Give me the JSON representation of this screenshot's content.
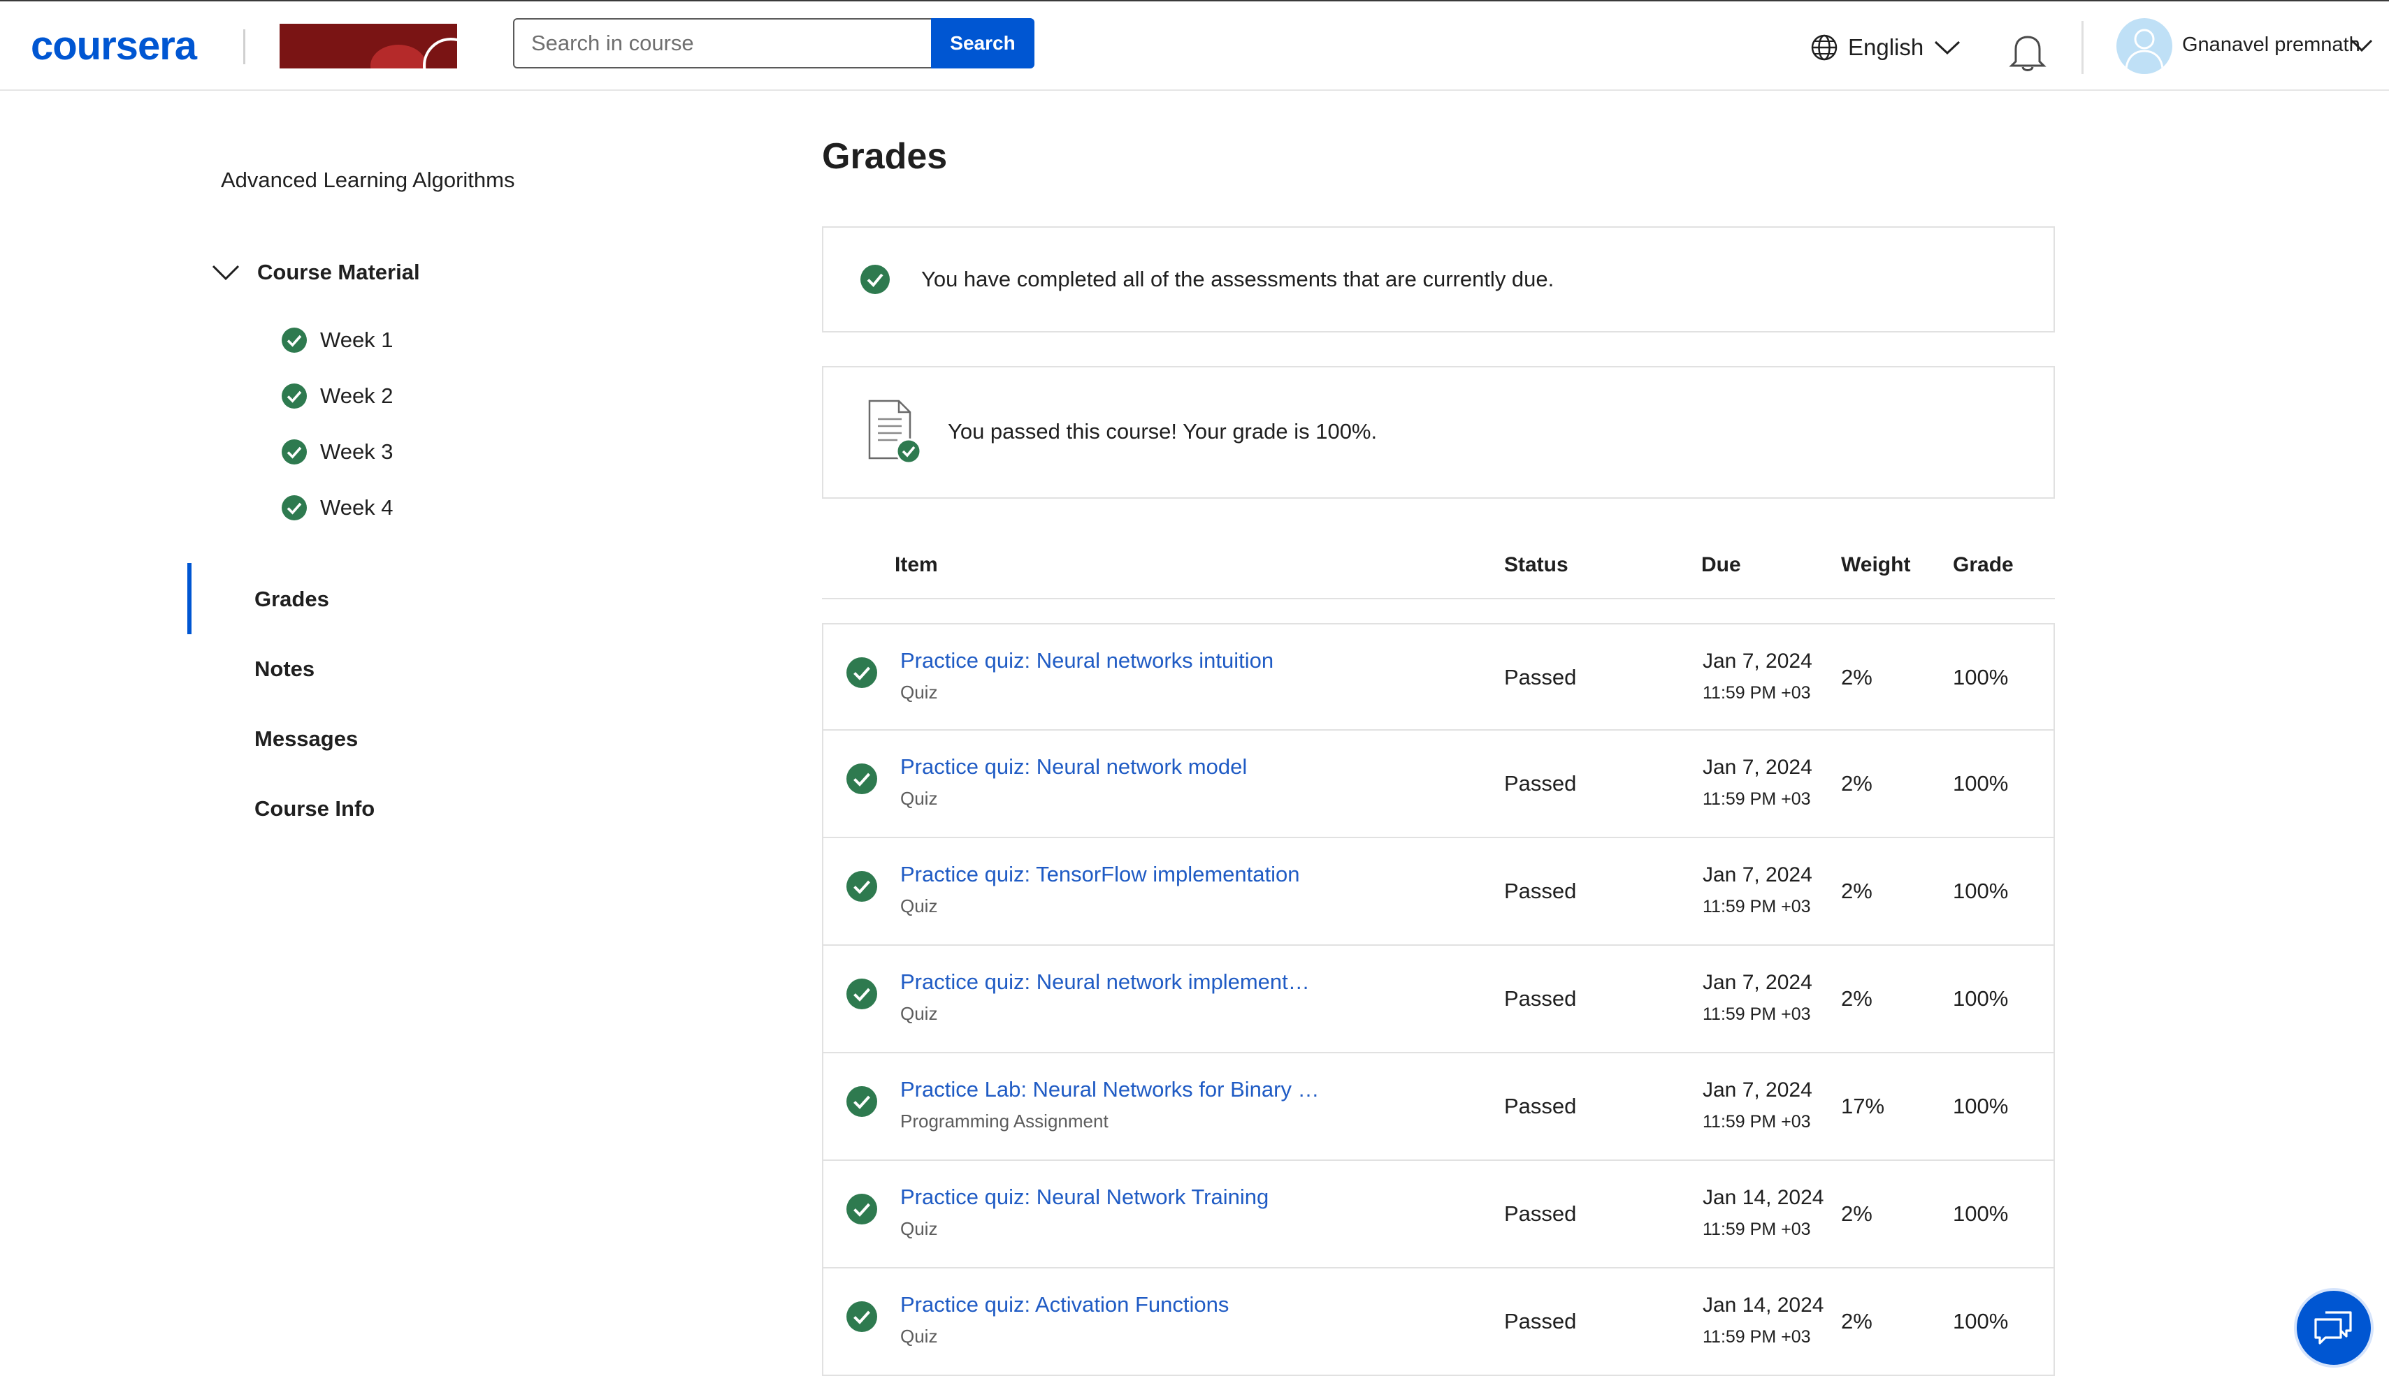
{
  "header": {
    "logo_text": "coursera",
    "search_placeholder": "Search in course",
    "search_button": "Search",
    "language": "English",
    "username": "Gnanavel premnath"
  },
  "sidebar": {
    "course_title": "Advanced Learning Algorithms",
    "course_material_label": "Course Material",
    "weeks": [
      {
        "label": "Week 1"
      },
      {
        "label": "Week 2"
      },
      {
        "label": "Week 3"
      },
      {
        "label": "Week 4"
      }
    ],
    "nav": [
      {
        "label": "Grades",
        "active": true
      },
      {
        "label": "Notes",
        "active": false
      },
      {
        "label": "Messages",
        "active": false
      },
      {
        "label": "Course Info",
        "active": false
      }
    ]
  },
  "main": {
    "title": "Grades",
    "due_message": "You have completed all of the assessments that are currently due.",
    "passed_message": "You passed this course! Your grade is 100%.",
    "columns": {
      "item": "Item",
      "status": "Status",
      "due": "Due",
      "weight": "Weight",
      "grade": "Grade"
    },
    "rows": [
      {
        "title": "Practice quiz: Neural networks intuition",
        "type": "Quiz",
        "status": "Passed",
        "due_date": "Jan 7, 2024",
        "due_time": "11:59 PM +03",
        "weight": "2%",
        "grade": "100%"
      },
      {
        "title": "Practice quiz: Neural network model",
        "type": "Quiz",
        "status": "Passed",
        "due_date": "Jan 7, 2024",
        "due_time": "11:59 PM +03",
        "weight": "2%",
        "grade": "100%"
      },
      {
        "title": "Practice quiz: TensorFlow implementation",
        "type": "Quiz",
        "status": "Passed",
        "due_date": "Jan 7, 2024",
        "due_time": "11:59 PM +03",
        "weight": "2%",
        "grade": "100%"
      },
      {
        "title": "Practice quiz: Neural network implement…",
        "type": "Quiz",
        "status": "Passed",
        "due_date": "Jan 7, 2024",
        "due_time": "11:59 PM +03",
        "weight": "2%",
        "grade": "100%"
      },
      {
        "title": "Practice Lab: Neural Networks for Binary …",
        "type": "Programming Assignment",
        "status": "Passed",
        "due_date": "Jan 7, 2024",
        "due_time": "11:59 PM +03",
        "weight": "17%",
        "grade": "100%"
      },
      {
        "title": "Practice quiz: Neural Network Training",
        "type": "Quiz",
        "status": "Passed",
        "due_date": "Jan 14, 2024",
        "due_time": "11:59 PM +03",
        "weight": "2%",
        "grade": "100%"
      },
      {
        "title": "Practice quiz: Activation Functions",
        "type": "Quiz",
        "status": "Passed",
        "due_date": "Jan 14, 2024",
        "due_time": "11:59 PM +03",
        "weight": "2%",
        "grade": "100%"
      }
    ]
  },
  "colors": {
    "brand_blue": "#0056d2",
    "link_blue": "#1f5bc4",
    "check_green": "#2e7a4f"
  }
}
